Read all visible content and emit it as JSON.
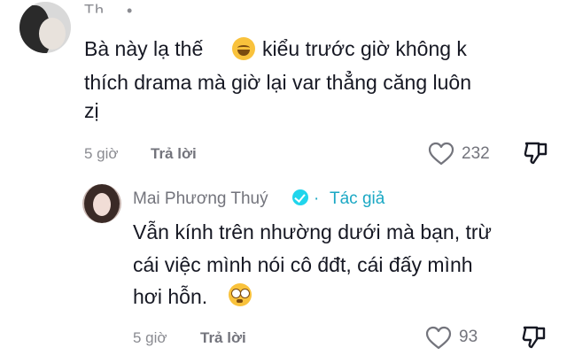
{
  "comment1": {
    "username": "Th… • ",
    "text_lines": [
      "Bà này lạ thế",
      "kiểu trước giờ không k",
      "thích drama mà giờ lại var thẳng căng luôn",
      "zị"
    ],
    "time": "5 giờ",
    "reply_label": "Trả lời",
    "likes": "232"
  },
  "comment2": {
    "username": "Mai Phương Thuý",
    "separator": "·",
    "author_label": "Tác giả",
    "text_lines": [
      "Vẫn kính trên nhường dưới mà bạn, trừ",
      "cái việc mình nói cô d́đt",
      ", cái đấy mình",
      "hơi hỗn."
    ],
    "time": "5 giờ",
    "reply_label": "Trả lời",
    "likes": "93"
  },
  "icons": {
    "like": "heart-outline-icon",
    "dislike": "thumbs-down-outline-icon",
    "verified": "verified-badge-icon",
    "emoji1": "rolling-on-floor-laughing-emoji",
    "emoji2": "flushed-face-emoji"
  },
  "colors": {
    "author_accent": "#1ba8c4",
    "verified": "#20d5ec"
  }
}
